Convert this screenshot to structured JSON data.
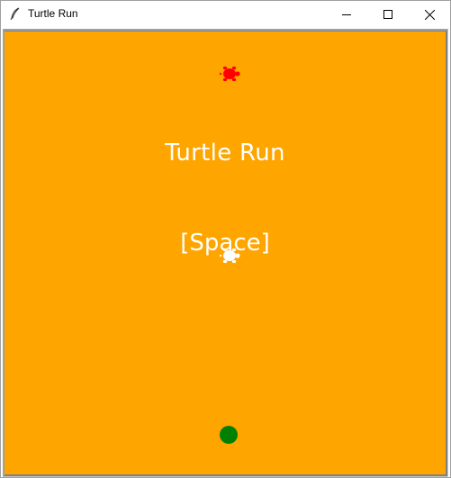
{
  "window": {
    "title": "Turtle Run",
    "icon": "feather-icon",
    "controls": {
      "minimize_icon": "minimize-icon",
      "maximize_icon": "maximize-icon",
      "close_icon": "close-icon"
    }
  },
  "game": {
    "title": "Turtle Run",
    "prompt": "[Space]",
    "background_color": "#ffa500",
    "text_color": "#ffffff",
    "enemy_turtle_color": "#ff0000",
    "player_turtle_color": "#ffffff",
    "goal_color": "#008000"
  }
}
